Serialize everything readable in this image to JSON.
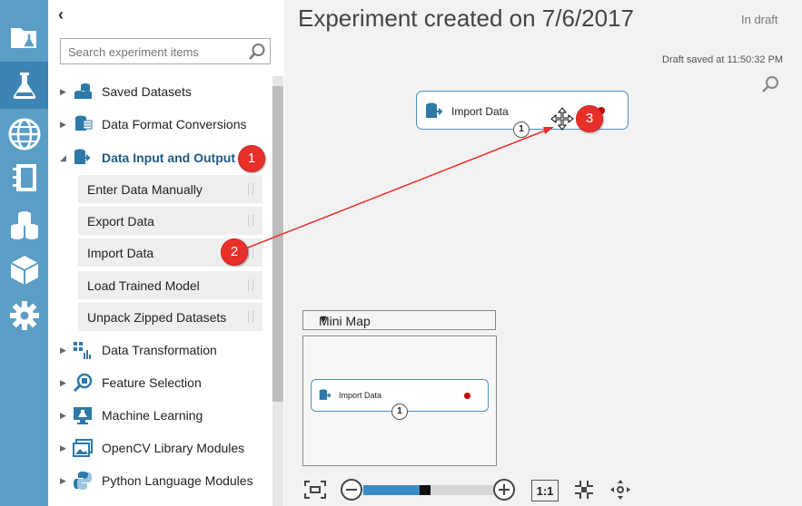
{
  "palette": {
    "collapse_glyph": "‹",
    "search_placeholder": "Search experiment items",
    "categories": [
      {
        "label": "Saved Datasets",
        "expanded": false
      },
      {
        "label": "Data Format Conversions",
        "expanded": false
      },
      {
        "label": "Data Input and Output",
        "expanded": true
      },
      {
        "label": "Data Transformation",
        "expanded": false
      },
      {
        "label": "Feature Selection",
        "expanded": false
      },
      {
        "label": "Machine Learning",
        "expanded": false
      },
      {
        "label": "OpenCV Library Modules",
        "expanded": false
      },
      {
        "label": "Python Language Modules",
        "expanded": false
      }
    ],
    "modules": [
      "Enter Data Manually",
      "Export Data",
      "Import Data",
      "Load Trained Model",
      "Unpack Zipped Datasets"
    ]
  },
  "rail_icons": [
    "projects-icon",
    "experiments-icon",
    "web-services-icon",
    "notebooks-icon",
    "datasets-icon",
    "trained-models-icon",
    "settings-icon"
  ],
  "canvas": {
    "title": "Experiment created on 7/6/2017",
    "status": "In draft",
    "saved": "Draft saved at 11:50:32 PM",
    "node": {
      "label": "Import Data",
      "port": "1"
    }
  },
  "annotations": [
    "1",
    "2",
    "3"
  ],
  "minimap": {
    "title": "Mini Map",
    "node": {
      "label": "Import Data",
      "port": "1"
    }
  },
  "toolbar": {
    "ratio_label": "1:1",
    "zoom_level": 0.48
  },
  "colors": {
    "rail": "#5a9ec6",
    "rail_active": "#3c84b3",
    "accent": "#3a8cc4",
    "annotation": "#e8302a",
    "error": "#c00000"
  }
}
